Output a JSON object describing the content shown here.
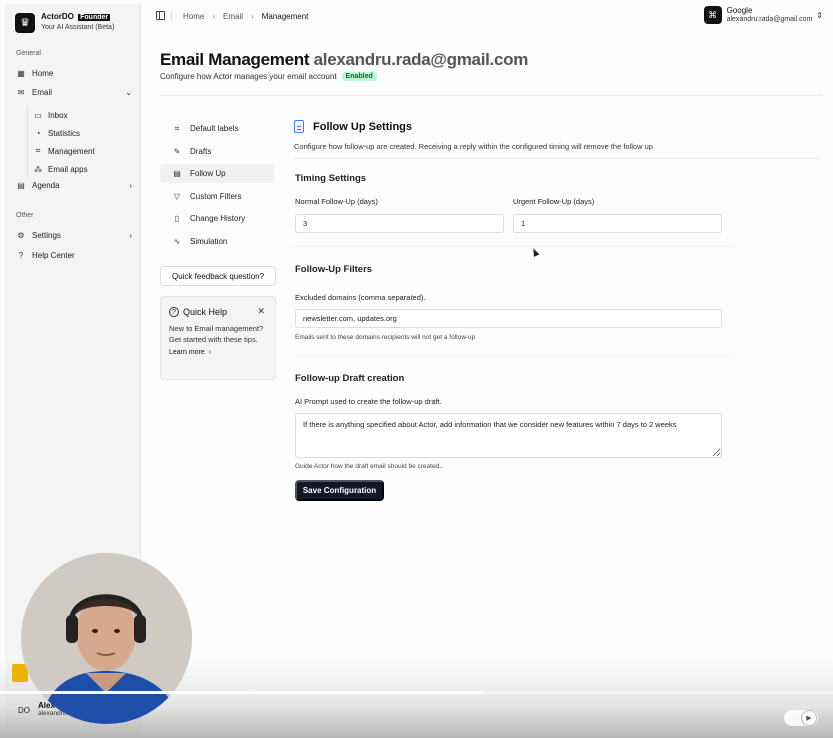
{
  "sidebar": {
    "brand_name": "ActorDO",
    "brand_badge": "Founder",
    "brand_sub": "Your AI Assistant (Beta)",
    "section_general": "General",
    "section_other": "Other",
    "items": {
      "home": "Home",
      "email": "Email",
      "inbox": "Inbox",
      "statistics": "Statistics",
      "management": "Management",
      "email_apps": "Email apps",
      "agenda": "Agenda",
      "settings": "Settings",
      "help_center": "Help Center"
    },
    "user": {
      "initials": "DO",
      "name": "Alex",
      "email": "alexandru"
    }
  },
  "header": {
    "breadcrumbs": [
      "Home",
      "Email",
      "Management"
    ],
    "account_name": "Google",
    "account_email": "alexandru.rada@gmail.com"
  },
  "page": {
    "title": "Email Management",
    "title_email": "alexandru.rada@gmail.com",
    "subtitle": "Configure how Actor manages your email account",
    "status_badge": "Enabled"
  },
  "subnav": {
    "items": [
      "Default labels",
      "Drafts",
      "Follow Up",
      "Custom Filters",
      "Change History",
      "Simulation"
    ],
    "active": "Follow Up"
  },
  "feedback": {
    "button_label": "Quick feedback question?"
  },
  "quick_help": {
    "title": "Quick Help",
    "body": "New to Email management? Get started with these tips.",
    "link": "Learn more"
  },
  "follow_up": {
    "title": "Follow Up Settings",
    "description": "Configure how follow-up are created. Receiving a reply within the configured timing will remove the follow up",
    "timing": {
      "heading": "Timing Settings",
      "normal_label": "Normal Follow-Up (days)",
      "normal_value": "3",
      "urgent_label": "Urgent Follow-Up (days)",
      "urgent_value": "1"
    },
    "filters": {
      "heading": "Follow-Up Filters",
      "excluded_label": "Excluded domains (comma separated).",
      "excluded_value": "newsletter.com, updates.org",
      "excluded_hint": "Emails sent to these domains recipients will not get a follow-up"
    },
    "draft": {
      "heading": "Follow-up Draft creation",
      "prompt_label": "AI Prompt used to create the follow-up draft.",
      "prompt_value": "If there is anything specified about Actor, add information that we consider new features within 7 days to 2 weeks",
      "prompt_hint": "Guide Actor how the draft email should be created.."
    },
    "save_label": "Save Configuration"
  },
  "video": {
    "progress": 0.58
  },
  "icons": {
    "brand": "crown-icon",
    "account": "command-icon",
    "page_section": "document-icon"
  }
}
